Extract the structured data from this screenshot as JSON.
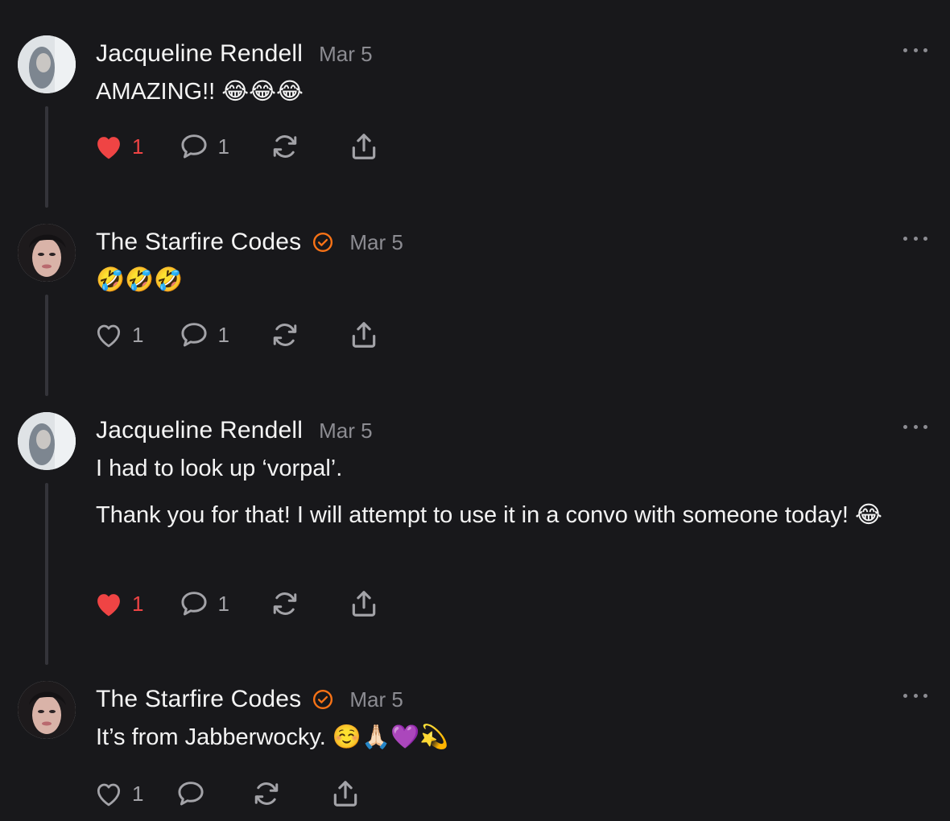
{
  "posts": [
    {
      "author": "Jacqueline Rendell",
      "verified": false,
      "date": "Mar 5",
      "paragraphs": [
        "AMAZING!! 😂😂😂"
      ],
      "liked": true,
      "likes": "1",
      "replies": "1"
    },
    {
      "author": "The Starfire Codes",
      "verified": true,
      "date": "Mar 5",
      "paragraphs": [
        "🤣🤣🤣"
      ],
      "liked": false,
      "likes": "1",
      "replies": "1"
    },
    {
      "author": "Jacqueline Rendell",
      "verified": false,
      "date": "Mar 5",
      "paragraphs": [
        "I had to look up ‘vorpal’.",
        "Thank you for that! I will attempt to use it in a convo with someone today! 😂"
      ],
      "liked": true,
      "likes": "1",
      "replies": "1"
    },
    {
      "author": "The Starfire Codes",
      "verified": true,
      "date": "Mar 5",
      "paragraphs": [
        "It’s from Jabberwocky. ☺️🙏🏻💜💫"
      ],
      "liked": false,
      "likes": "1",
      "replies": ""
    }
  ],
  "colors": {
    "background": "#18181b",
    "like_active": "#ef4444",
    "verified_badge": "#f97316",
    "muted": "#8c8c92"
  },
  "icons": {
    "like": "heart-icon",
    "reply": "comment-bubble-icon",
    "repost": "repost-icon",
    "share": "share-icon",
    "more": "more-dots-icon",
    "verified": "verified-check-icon"
  }
}
